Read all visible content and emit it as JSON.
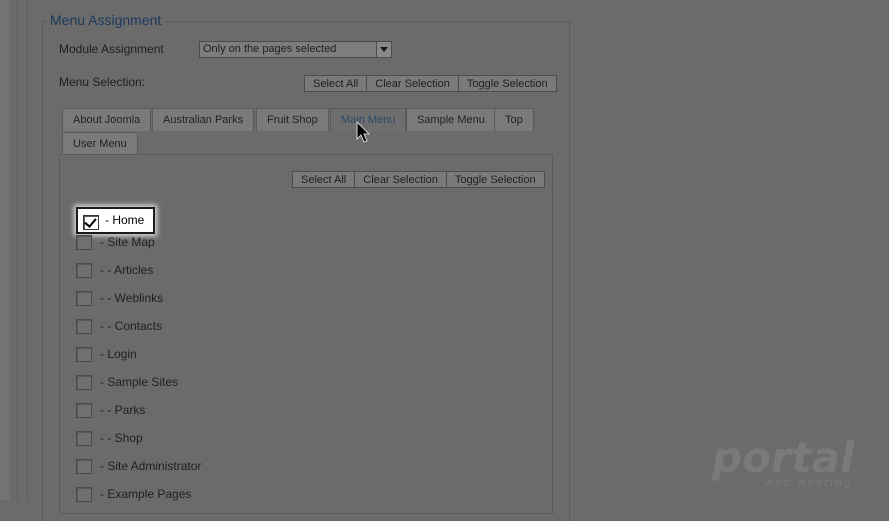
{
  "fieldset": {
    "legend": "Menu Assignment"
  },
  "module_assignment": {
    "label": "Module Assignment",
    "selected": "Only on the pages selected"
  },
  "menu_selection": {
    "label": "Menu Selection:",
    "buttons": [
      "Select All",
      "Clear Selection",
      "Toggle Selection"
    ]
  },
  "tabs": [
    {
      "label": "About Joomla",
      "active": false
    },
    {
      "label": "Australian Parks",
      "active": false
    },
    {
      "label": "Fruit Shop",
      "active": false
    },
    {
      "label": "Main Menu",
      "active": true
    },
    {
      "label": "Sample Menu",
      "active": false
    },
    {
      "label": "Top",
      "active": false
    },
    {
      "label": "User Menu",
      "active": false
    }
  ],
  "panel": {
    "buttons": [
      "Select All",
      "Clear Selection",
      "Toggle Selection"
    ],
    "items": [
      {
        "label": "- Home",
        "checked": true
      },
      {
        "label": "- Site Map",
        "checked": false
      },
      {
        "label": "- - Articles",
        "checked": false
      },
      {
        "label": "- - Weblinks",
        "checked": false
      },
      {
        "label": "- - Contacts",
        "checked": false
      },
      {
        "label": "- Login",
        "checked": false
      },
      {
        "label": "- Sample Sites",
        "checked": false
      },
      {
        "label": "- - Parks",
        "checked": false
      },
      {
        "label": "- - Shop",
        "checked": false
      },
      {
        "label": "- Site Administrator",
        "checked": false
      },
      {
        "label": "- Example Pages",
        "checked": false
      }
    ]
  },
  "watermark": {
    "brand": "portal",
    "tagline": "web hosting"
  },
  "colors": {
    "overlay": "#6b6b6b",
    "legend": "#1c3a5c",
    "active_tab": "#2b4a6b",
    "watermark": "#7a7a7a"
  }
}
